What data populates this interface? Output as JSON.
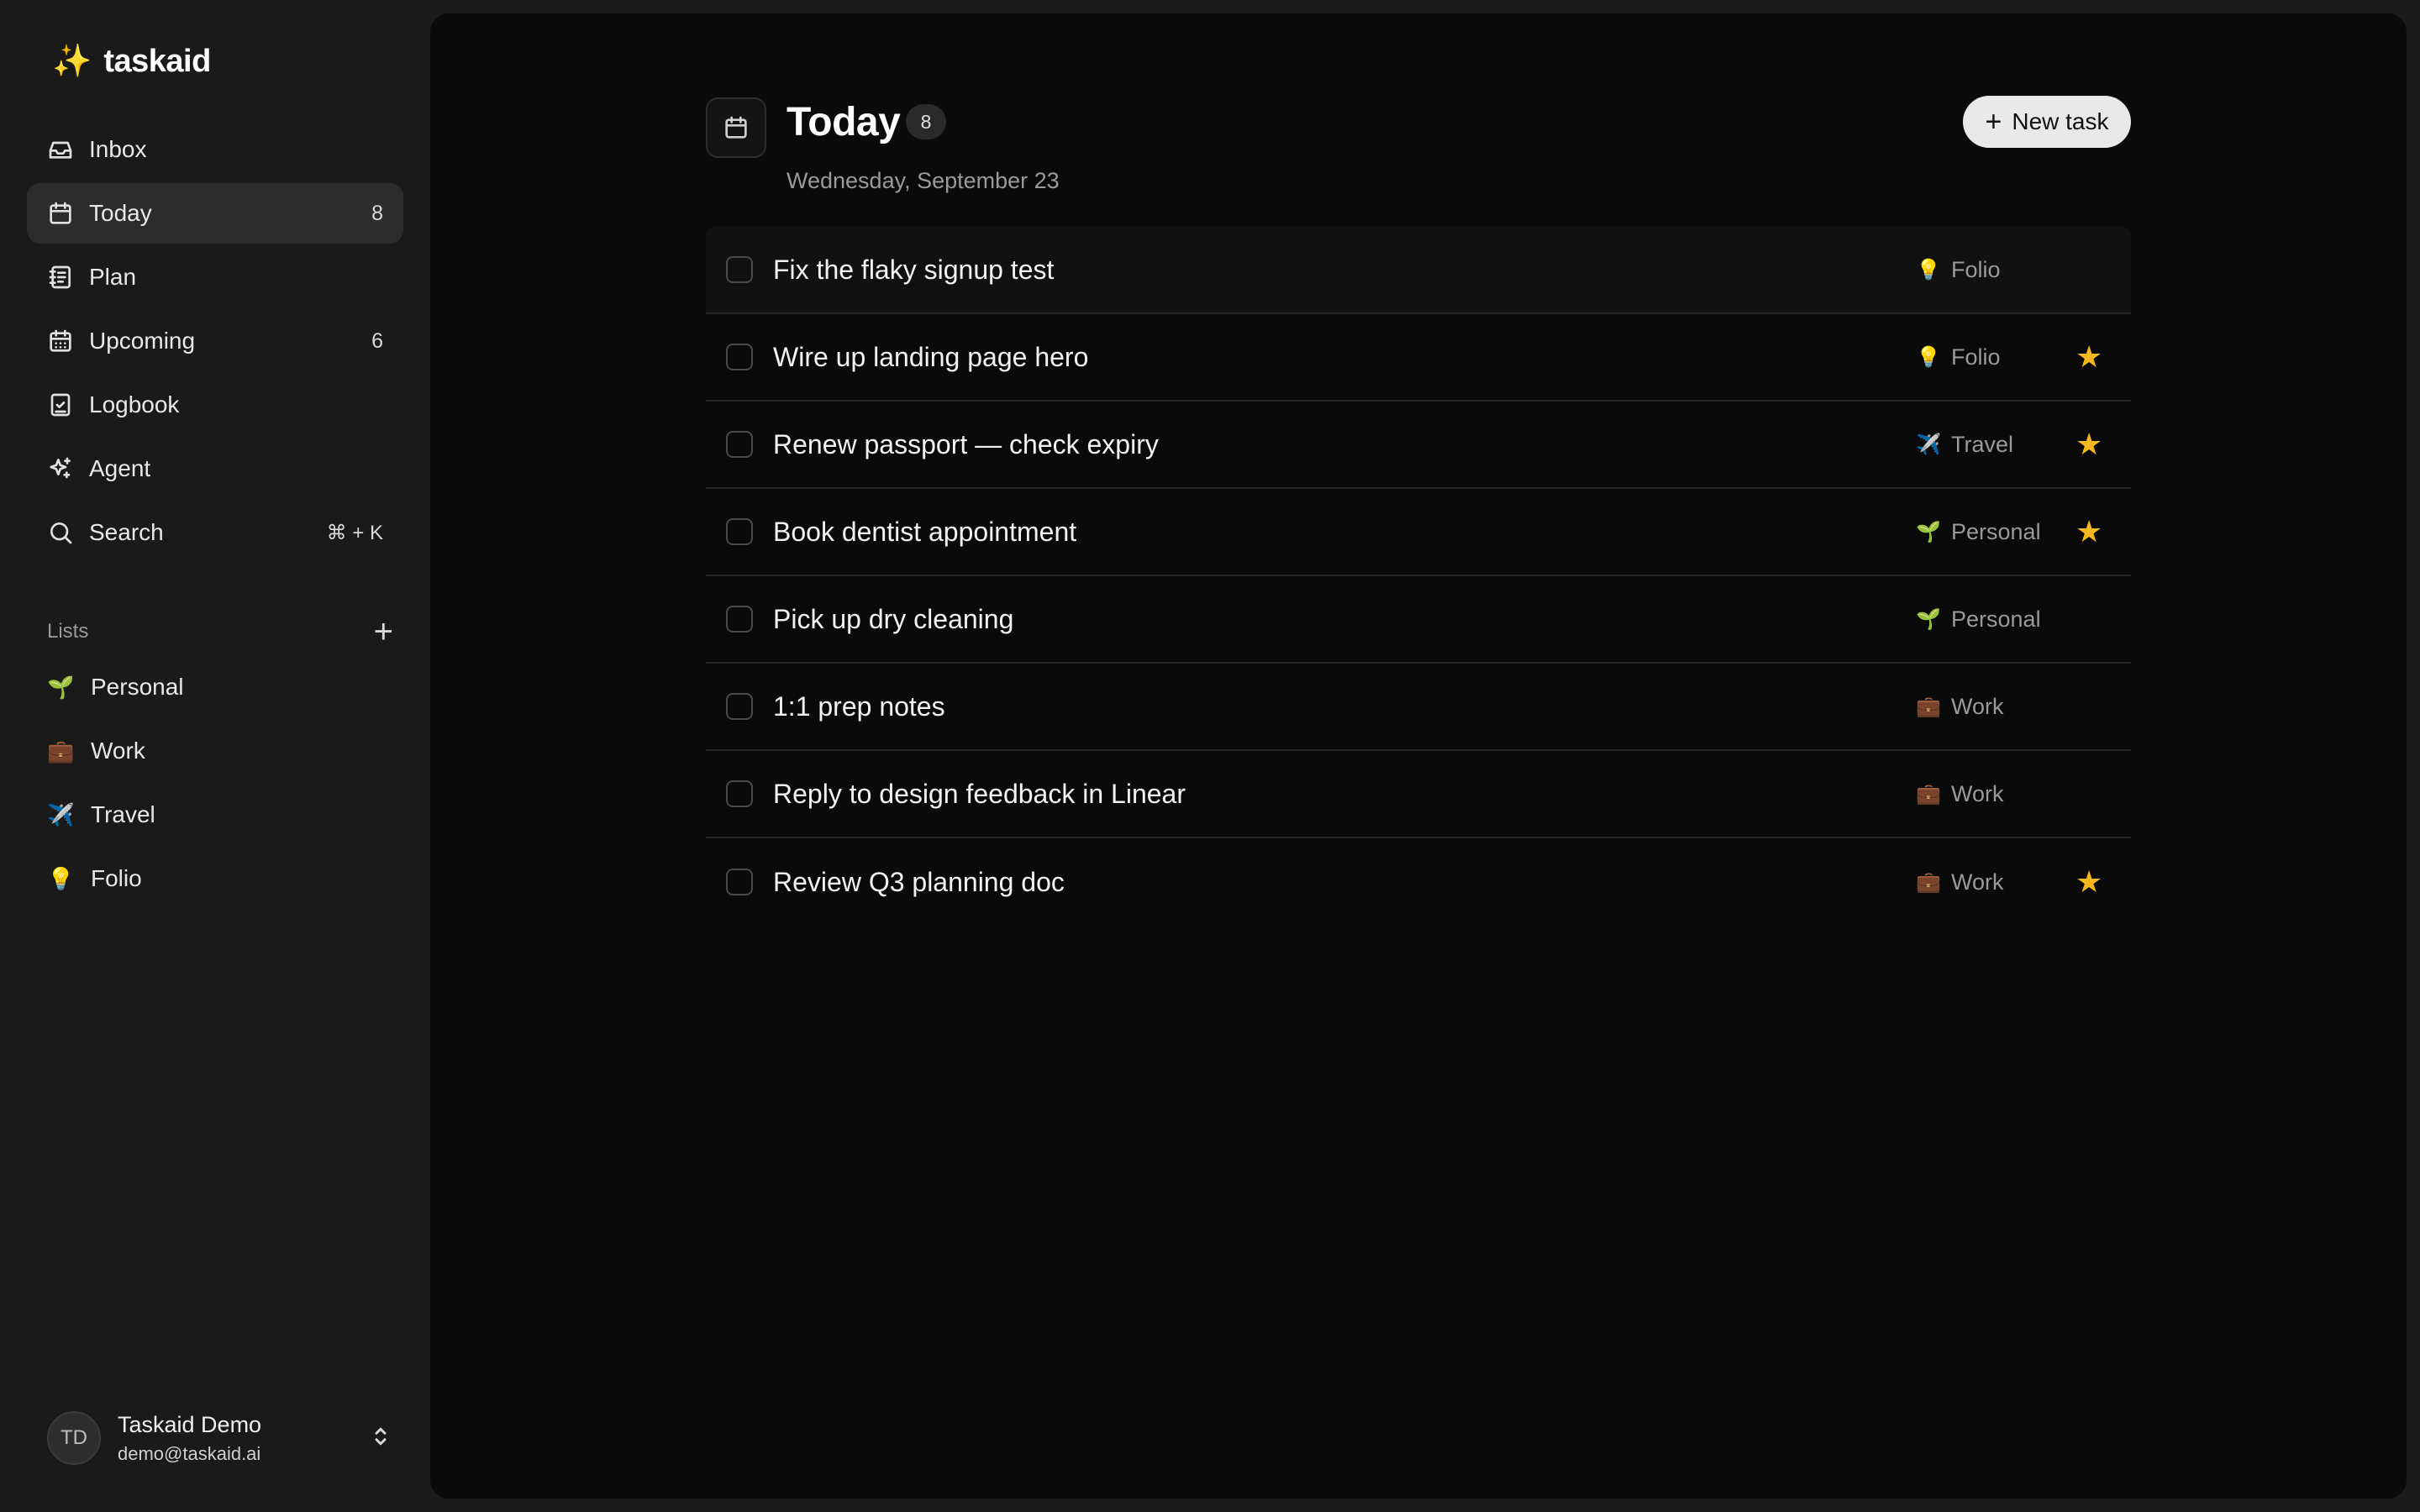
{
  "app": {
    "logo_icon": "✨",
    "name": "taskaid"
  },
  "nav": {
    "items": [
      {
        "label": "Inbox",
        "icon": "inbox-icon",
        "count": ""
      },
      {
        "label": "Today",
        "icon": "calendar-icon",
        "count": "8"
      },
      {
        "label": "Plan",
        "icon": "notebook-icon",
        "count": ""
      },
      {
        "label": "Upcoming",
        "icon": "calendar-dots-icon",
        "count": "6"
      },
      {
        "label": "Logbook",
        "icon": "logbook-icon",
        "count": ""
      },
      {
        "label": "Agent",
        "icon": "sparkle-icon",
        "count": ""
      },
      {
        "label": "Search",
        "icon": "search-icon",
        "shortcut": "⌘ + K"
      }
    ]
  },
  "lists": {
    "title": "Lists",
    "add": "+",
    "items": [
      {
        "emoji": "🌱",
        "label": "Personal"
      },
      {
        "emoji": "💼",
        "label": "Work"
      },
      {
        "emoji": "✈️",
        "label": "Travel"
      },
      {
        "emoji": "💡",
        "label": "Folio"
      }
    ]
  },
  "user": {
    "initials": "TD",
    "name": "Taskaid Demo",
    "email": "demo@taskaid.ai"
  },
  "main": {
    "title": "Today",
    "count": "8",
    "subtitle": "Wednesday, September 23",
    "new_task_plus": "+",
    "new_task_label": "New task",
    "star_color": "#f5b91e",
    "tasks": [
      {
        "title": "Fix the flaky signup test",
        "list_emoji": "💡",
        "list": "Folio",
        "star": ""
      },
      {
        "title": "Wire up landing page hero",
        "list_emoji": "💡",
        "list": "Folio",
        "star": "★"
      },
      {
        "title": "Renew passport — check expiry",
        "list_emoji": "✈️",
        "list": "Travel",
        "star": "★"
      },
      {
        "title": "Book dentist appointment",
        "list_emoji": "🌱",
        "list": "Personal",
        "star": "★"
      },
      {
        "title": "Pick up dry cleaning",
        "list_emoji": "🌱",
        "list": "Personal",
        "star": ""
      },
      {
        "title": "1:1 prep notes",
        "list_emoji": "💼",
        "list": "Work",
        "star": ""
      },
      {
        "title": "Reply to design feedback in Linear",
        "list_emoji": "💼",
        "list": "Work",
        "star": ""
      },
      {
        "title": "Review Q3 planning doc",
        "list_emoji": "💼",
        "list": "Work",
        "star": "★"
      }
    ]
  }
}
